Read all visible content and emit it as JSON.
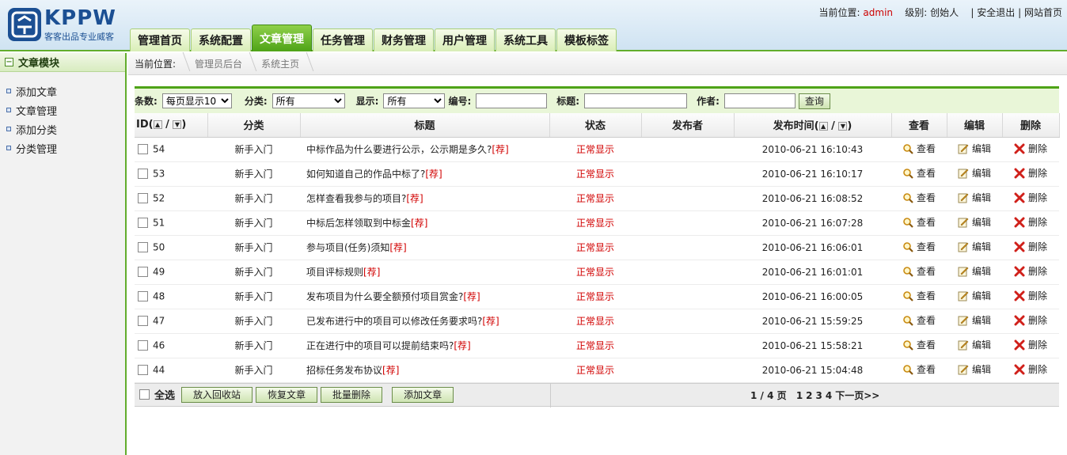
{
  "logo": {
    "brand": "KPPW",
    "slogan": "客客出品专业威客"
  },
  "topinfo": {
    "location_label": "当前位置:",
    "user": "admin",
    "level_label": "级别:",
    "level": "创始人",
    "logout": "安全退出",
    "site_home": "网站首页"
  },
  "nav": [
    "管理首页",
    "系统配置",
    "文章管理",
    "任务管理",
    "财务管理",
    "用户管理",
    "系统工具",
    "模板标签"
  ],
  "sidebar": {
    "title": "文章模块",
    "items": [
      "添加文章",
      "文章管理",
      "添加分类",
      "分类管理"
    ]
  },
  "breadcrumb": [
    "当前位置:",
    "管理员后台",
    "系统主页"
  ],
  "filter": {
    "count_label": "条数:",
    "count_value": "每页显示10",
    "category_label": "分类:",
    "category_value": "所有",
    "display_label": "显示:",
    "display_value": "所有",
    "id_label": "编号:",
    "title_label": "标题:",
    "author_label": "作者:",
    "query_button": "查询"
  },
  "table": {
    "headers": {
      "id": "ID(",
      "id_suffix": ")",
      "category": "分类",
      "title": "标题",
      "status": "状态",
      "publisher": "发布者",
      "time": "发布时间(",
      "time_suffix": ")",
      "view": "查看",
      "edit": "编辑",
      "delete": "删除"
    },
    "view_label": "查看",
    "edit_label": "编辑",
    "delete_label": "删除",
    "rec_tag": "[荐]",
    "rows": [
      {
        "id": "54",
        "category": "新手入门",
        "title": "中标作品为什么要进行公示，公示期是多久?",
        "status": "正常显示",
        "time": "2010-06-21 16:10:43"
      },
      {
        "id": "53",
        "category": "新手入门",
        "title": "如何知道自己的作品中标了?",
        "status": "正常显示",
        "time": "2010-06-21 16:10:17"
      },
      {
        "id": "52",
        "category": "新手入门",
        "title": "怎样查看我参与的项目?",
        "status": "正常显示",
        "time": "2010-06-21 16:08:52"
      },
      {
        "id": "51",
        "category": "新手入门",
        "title": "中标后怎样领取到中标金",
        "status": "正常显示",
        "time": "2010-06-21 16:07:28"
      },
      {
        "id": "50",
        "category": "新手入门",
        "title": "参与项目(任务)须知",
        "status": "正常显示",
        "time": "2010-06-21 16:06:01"
      },
      {
        "id": "49",
        "category": "新手入门",
        "title": "项目评标规则",
        "status": "正常显示",
        "time": "2010-06-21 16:01:01"
      },
      {
        "id": "48",
        "category": "新手入门",
        "title": "发布项目为什么要全额预付项目赏金?",
        "status": "正常显示",
        "time": "2010-06-21 16:00:05"
      },
      {
        "id": "47",
        "category": "新手入门",
        "title": "已发布进行中的项目可以修改任务要求吗?",
        "status": "正常显示",
        "time": "2010-06-21 15:59:25"
      },
      {
        "id": "46",
        "category": "新手入门",
        "title": "正在进行中的项目可以提前结束吗?",
        "status": "正常显示",
        "time": "2010-06-21 15:58:21"
      },
      {
        "id": "44",
        "category": "新手入门",
        "title": "招标任务发布协议",
        "status": "正常显示",
        "time": "2010-06-21 15:04:48"
      }
    ]
  },
  "footer": {
    "select_all": "全选",
    "buttons": [
      "放入回收站",
      "恢复文章",
      "批量删除",
      "添加文章"
    ],
    "page_info": "1 / 4 页",
    "pages": [
      "1",
      "2",
      "3",
      "4"
    ],
    "next": "下一页>>"
  }
}
